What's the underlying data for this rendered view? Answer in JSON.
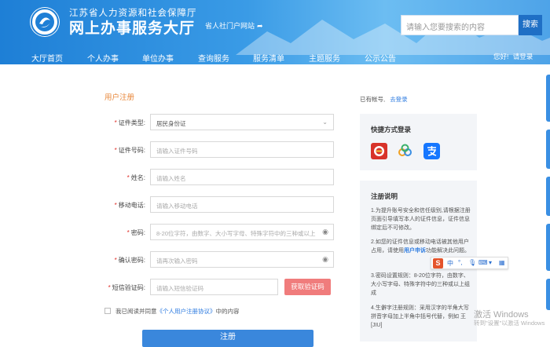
{
  "header": {
    "org_name": "江苏省人力资源和社会保障厅",
    "hall_name": "网上办事服务大厅",
    "portal_link": "省人社门户网站",
    "search": {
      "placeholder": "请输入您要搜索的内容",
      "button": "搜索"
    }
  },
  "nav": {
    "items": [
      "大厅首页",
      "个人办事",
      "单位办事",
      "查询服务",
      "服务清单",
      "主题服务",
      "公示公告"
    ],
    "greeting": "您好!",
    "login": "请登录"
  },
  "form": {
    "section_title": "用户注册",
    "fields": [
      {
        "label": "证件类型:",
        "value": "居民身份证",
        "placeholder": ""
      },
      {
        "label": "证件号码:",
        "value": "",
        "placeholder": "请输入证件号码"
      },
      {
        "label": "姓名:",
        "value": "",
        "placeholder": "请输入姓名"
      },
      {
        "label": "移动电话:",
        "value": "",
        "placeholder": "请输入移动电话"
      },
      {
        "label": "密码:",
        "value": "",
        "placeholder": "8-20位字符，由数字、大小写字母、特殊字符中的三种或以上"
      },
      {
        "label": "确认密码:",
        "value": "",
        "placeholder": "请再次输入密码"
      },
      {
        "label": "短信验证码:",
        "value": "",
        "placeholder": "请输入短信验证码"
      }
    ],
    "sms_button": "获取验证码",
    "agree_prefix": "我已阅读并同意",
    "agree_link": "《个人用户注册协议》",
    "agree_suffix": "中的内容",
    "submit": "注册"
  },
  "sidebar": {
    "have_account": "已有帐号,",
    "login_link": "去登录",
    "quick_login_title": "快捷方式登录",
    "quick_login_icons": [
      "jiangsu-gov-app-icon",
      "link-app-icon",
      "alipay-icon"
    ],
    "notes_title": "注册说明",
    "note1": "1.为提升账号安全和信任级别,请根据注册页面引导填写本人的证件信息，证件信息绑定后不可修改。",
    "note2_before": "2.如您的证件信息或移动电话被其他用户占用，请使用",
    "note2_link": "用户申诉",
    "note2_after": "功能解决此问题。",
    "note3": "3.密码设置规则：8-20位字符，由数字、大小写字母、特殊字符中的三种或以上组成",
    "note4": "4.生僻字注册规则：采用汉字的半角大写拼音字母加上半角中括号代替，例如 王[JIU]"
  },
  "ime": {
    "label": "S",
    "items": [
      "中",
      "°,",
      "mic",
      "kbd",
      "shirt",
      "grid"
    ]
  },
  "watermark": {
    "line1": "激活 Windows",
    "line2": "转到\"设置\"以激活 Windows"
  },
  "colors": {
    "brand_blue": "#1e7fd6",
    "accent_orange": "#e8873a",
    "sms_button": "#f07c7c",
    "submit": "#3a87dc",
    "link": "#2d7be0"
  }
}
